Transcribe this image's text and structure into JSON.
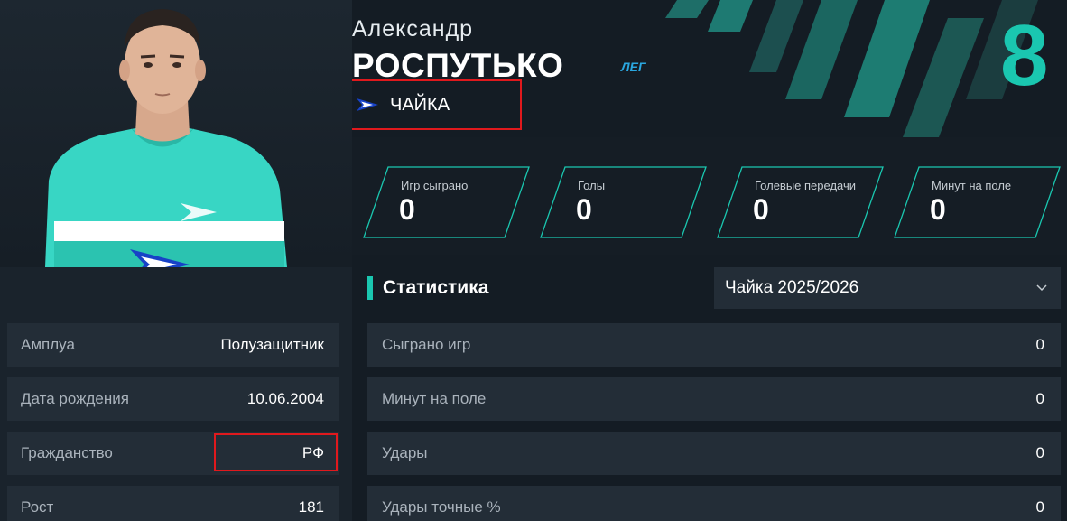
{
  "player": {
    "first_name": "Александр",
    "last_name": "РОСПУТЬКО",
    "position_tag": "ЛЕГ",
    "number": "8",
    "club": "ЧАЙКА"
  },
  "info": [
    {
      "key": "Амплуа",
      "value": "Полузащитник"
    },
    {
      "key": "Дата рождения",
      "value": "10.06.2004"
    },
    {
      "key": "Гражданство",
      "value": "РФ"
    },
    {
      "key": "Рост",
      "value": "181"
    }
  ],
  "cards": [
    {
      "label": "Игр сыграно",
      "value": "0"
    },
    {
      "label": "Голы",
      "value": "0"
    },
    {
      "label": "Голевые передачи",
      "value": "0"
    },
    {
      "label": "Минут на поле",
      "value": "0"
    }
  ],
  "stats": {
    "title": "Статистика",
    "season": "Чайка 2025/2026",
    "rows": [
      {
        "key": "Сыграно игр",
        "value": "0"
      },
      {
        "key": "Минут на поле",
        "value": "0"
      },
      {
        "key": "Удары",
        "value": "0"
      },
      {
        "key": "Удары точные %",
        "value": "0"
      }
    ]
  },
  "colors": {
    "accent": "#1ac7b0",
    "background": "#141c24",
    "panel": "#232d37",
    "highlight": "#e0191d",
    "position_tag": "#2aa7e0"
  },
  "icons": [
    "club-logo-icon",
    "chevron-down-icon"
  ]
}
